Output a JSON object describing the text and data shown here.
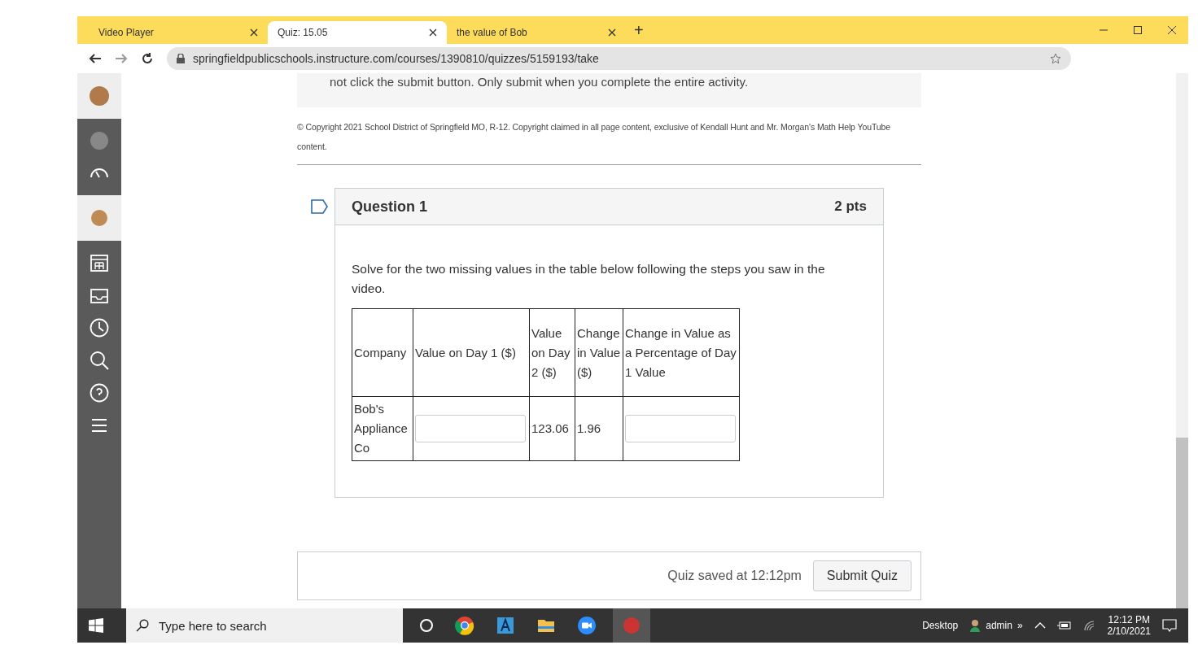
{
  "browser": {
    "tabs": [
      {
        "title": "Video Player",
        "selected": false
      },
      {
        "title": "Quiz: 15.05",
        "selected": true
      },
      {
        "title": "the value of Bob",
        "selected": false
      }
    ],
    "new_tab": "+",
    "url": "springfieldpublicschools.instructure.com/courses/1390810/quizzes/5159193/take"
  },
  "notice": "not click the submit button. Only submit when you complete the entire activity.",
  "copyright": "© Copyright 2021 School District of Springfield MO, R-12. Copyright claimed in all page content, exclusive of Kendall Hunt and Mr. Morgan's Math Help YouTube content.",
  "question": {
    "title": "Question 1",
    "points": "2 pts",
    "prompt": "Solve for the two missing values in the table below following the steps you saw in the video.",
    "table": {
      "columns": [
        "Company",
        "Value on Day 1 ($)",
        "Value on Day 2 ($)",
        "Change in Value ($)",
        "Change in Value as a Percentage of Day 1 Value"
      ],
      "rows": [
        {
          "cells": [
            {
              "kind": "text",
              "text": "Bob's Appliance Co"
            },
            {
              "kind": "input"
            },
            {
              "kind": "text",
              "text": "123.06"
            },
            {
              "kind": "text",
              "text": "1.96"
            },
            {
              "kind": "input"
            }
          ]
        }
      ]
    }
  },
  "footer": {
    "status": "Quiz saved at 12:12pm",
    "submit": "Submit Quiz"
  },
  "taskbar": {
    "search_placeholder": "Type here to search",
    "toolbar": "Desktop",
    "user": "admin",
    "overflow": "»",
    "time": "12:12 PM",
    "date": "2/10/2021"
  }
}
